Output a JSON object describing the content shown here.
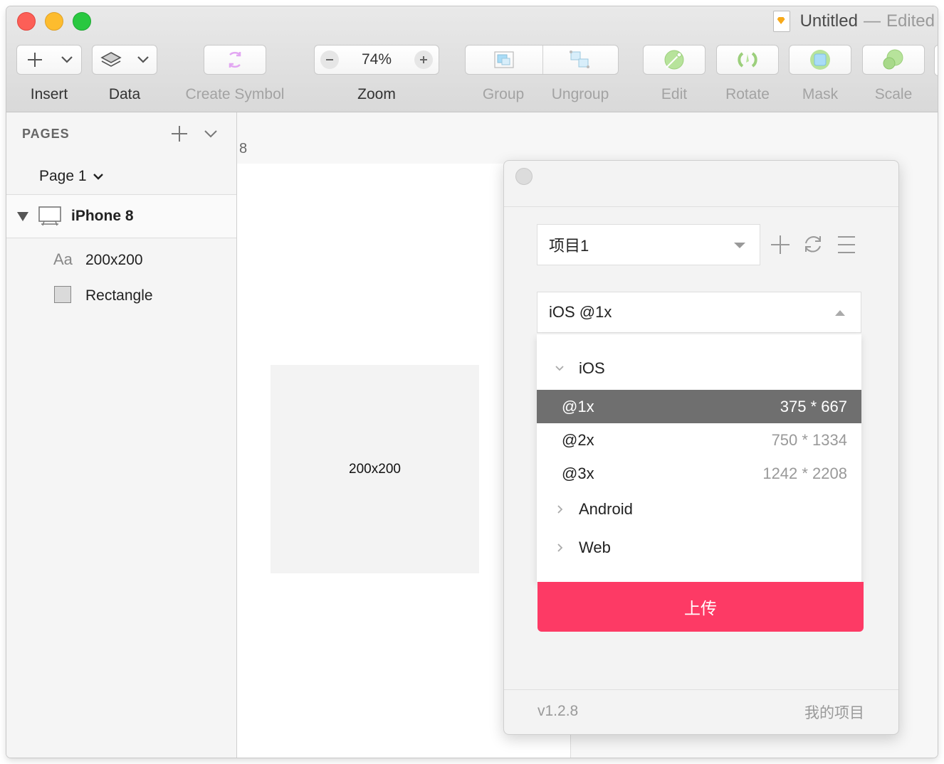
{
  "window": {
    "title": "Untitled",
    "title_separator": "—",
    "title_status": "Edited"
  },
  "toolbar": {
    "insert": "Insert",
    "data": "Data",
    "create_symbol": "Create Symbol",
    "zoom_label": "Zoom",
    "zoom_value": "74%",
    "group": "Group",
    "ungroup": "Ungroup",
    "edit": "Edit",
    "rotate": "Rotate",
    "mask": "Mask",
    "scale": "Scale"
  },
  "sidebar": {
    "pages_header": "PAGES",
    "current_page": "Page 1",
    "artboard": "iPhone 8",
    "layers": [
      {
        "icon": "text-layer-icon",
        "prefix": "Aa",
        "name": "200x200"
      },
      {
        "icon": "rectangle-layer-icon",
        "name": "Rectangle"
      }
    ]
  },
  "canvas": {
    "artboard_label": "8",
    "rect_text": "200x200"
  },
  "plugin": {
    "project_select": "项目1",
    "device_select": "iOS @1x",
    "groups": {
      "ios": "iOS",
      "android": "Android",
      "web": "Web"
    },
    "options": [
      {
        "scale": "@1x",
        "size": "375 * 667",
        "selected": true
      },
      {
        "scale": "@2x",
        "size": "750 * 1334",
        "selected": false
      },
      {
        "scale": "@3x",
        "size": "1242 * 2208",
        "selected": false
      }
    ],
    "upload_button": "上传",
    "version": "v1.2.8",
    "my_projects": "我的项目",
    "colors": {
      "upload": "#fd3a65",
      "selected_row": "#6f6f6f"
    }
  }
}
